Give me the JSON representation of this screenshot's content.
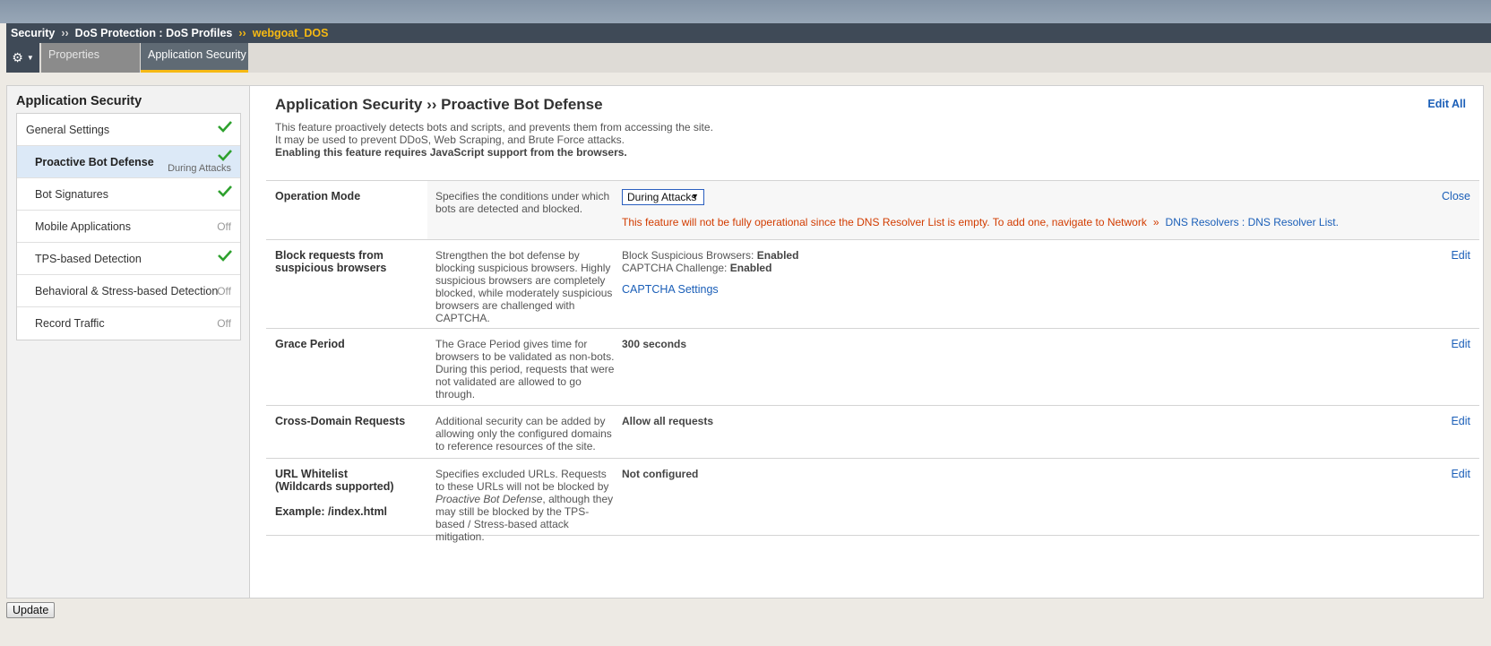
{
  "breadcrumb": {
    "items": [
      "Security",
      "DoS Protection : DoS Profiles"
    ],
    "current": "webgoat_DOS",
    "separator": "››"
  },
  "tabs": {
    "properties": "Properties",
    "app_security": "Application Security"
  },
  "sidebar": {
    "title": "Application Security",
    "items": [
      {
        "label": "General Settings",
        "status": "check"
      },
      {
        "label": "Proactive Bot Defense",
        "status": "check",
        "substatus": "During Attacks"
      },
      {
        "label": "Bot Signatures",
        "status": "check"
      },
      {
        "label": "Mobile Applications",
        "status": "Off"
      },
      {
        "label": "TPS-based Detection",
        "status": "check"
      },
      {
        "label": "Behavioral & Stress-based Detection",
        "status": "Off"
      },
      {
        "label": "Record Traffic",
        "status": "Off"
      }
    ]
  },
  "main": {
    "title": "Application Security ›› Proactive Bot Defense",
    "edit_all": "Edit All",
    "desc_line1": "This feature proactively detects bots and scripts, and prevents them from accessing the site.",
    "desc_line2": "It may be used to prevent DDoS, Web Scraping, and Brute Force attacks.",
    "desc_line3": "Enabling this feature requires JavaScript support from the browsers."
  },
  "rows": {
    "operation": {
      "name": "Operation Mode",
      "help": "Specifies the conditions under which bots are detected and blocked.",
      "select_value": "During Attacks",
      "action": "Close",
      "warning": "This feature will not be fully operational since the DNS Resolver List is empty. To add one, navigate to Network",
      "warning_sep": "»",
      "warning_link": "DNS Resolvers : DNS Resolver List."
    },
    "block": {
      "name": "Block requests from suspicious browsers",
      "help": "Strengthen the bot defense by blocking suspicious browsers. Highly suspicious browsers are completely blocked, while moderately suspicious browsers are challenged with CAPTCHA.",
      "label1": "Block Suspicious Browsers:",
      "value1": "Enabled",
      "label2": "CAPTCHA Challenge:",
      "value2": "Enabled",
      "link": "CAPTCHA Settings",
      "action": "Edit"
    },
    "grace": {
      "name": "Grace Period",
      "help": "The Grace Period gives time for browsers to be validated as non-bots. During this period, requests that were not validated are allowed to go through.",
      "value": "300 seconds",
      "action": "Edit"
    },
    "cross": {
      "name": "Cross-Domain Requests",
      "help": "Additional security can be added by allowing only the configured domains to reference resources of the site.",
      "value": "Allow all requests",
      "action": "Edit"
    },
    "url": {
      "name1": "URL Whitelist",
      "name2": "(Wildcards supported)",
      "example": "Example: /index.html",
      "help_a": "Specifies excluded URLs. Requests to these URLs will not be blocked by",
      "help_em": "Proactive Bot Defense",
      "help_b": ", although they may still be blocked by the TPS-based / Stress-based attack mitigation.",
      "value": "Not configured",
      "action": "Edit"
    }
  },
  "update_label": "Update",
  "colors": {
    "check": "#2ea12e",
    "accent": "#f6b913",
    "link": "#1b5fb8",
    "warning": "#d23c00"
  },
  "icons": {
    "gear": "gear-icon",
    "check": "check-icon",
    "caret": "caret-down-icon"
  }
}
